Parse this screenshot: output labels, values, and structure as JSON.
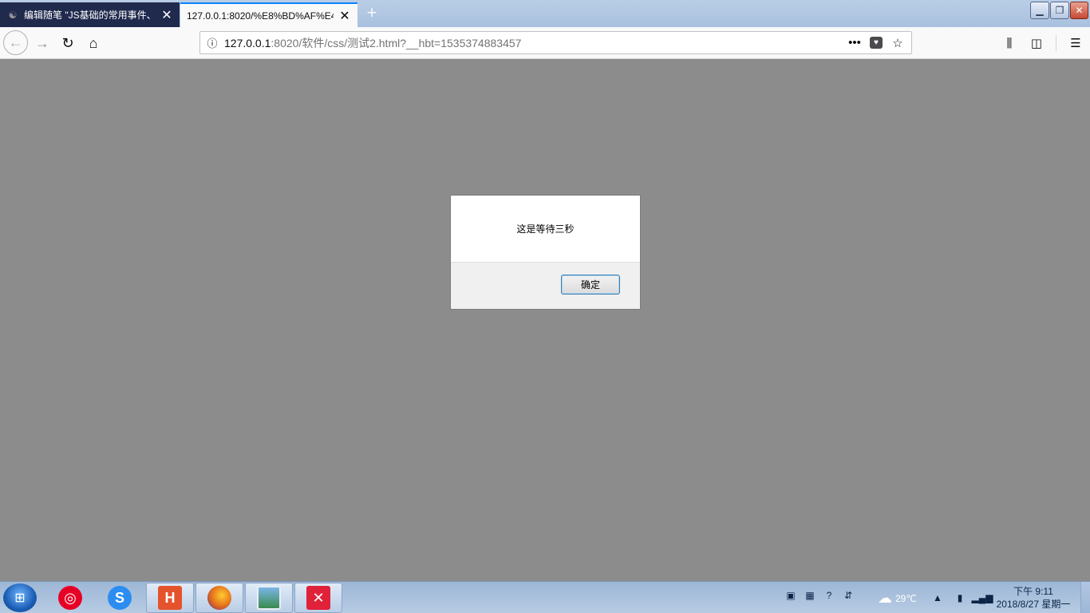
{
  "browser": {
    "tabs": [
      {
        "title": "编辑随笔 \"JS基础的常用事件、",
        "favicon": "cnblogs-icon",
        "active": false
      },
      {
        "title": "127.0.0.1:8020/%E8%BD%AF%E4",
        "favicon": "none",
        "active": true
      }
    ],
    "new_tab_label": "+",
    "url": {
      "host": "127.0.0.1",
      "rest": ":8020/软件/css/测试2.html?__hbt=1535374883457"
    }
  },
  "dialog": {
    "message": "这是等待三秒",
    "ok_label": "确定"
  },
  "taskbar": {
    "apps": [
      "netease-music-icon",
      "sogou-browser-icon",
      "hbuilder-icon",
      "firefox-icon",
      "photo-viewer-icon",
      "xmind-icon"
    ],
    "hbuilder_letter": "H",
    "weather": "29℃",
    "clock_time": "下午 9:11",
    "clock_date": "2018/8/27 星期一"
  }
}
